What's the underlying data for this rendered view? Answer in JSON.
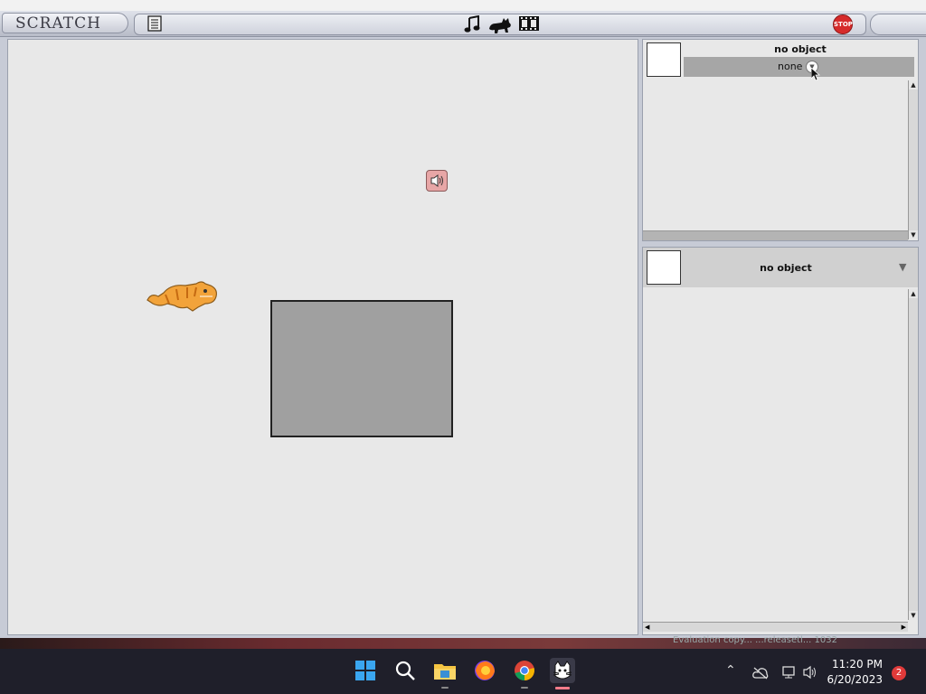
{
  "window": {
    "title_fragment": ""
  },
  "app": {
    "logo": "SCRATCH"
  },
  "toolbar": {
    "icons": [
      "notes-icon",
      "music-note-icon",
      "cat-icon",
      "film-icon"
    ],
    "stop_label": "STOP"
  },
  "top_pane": {
    "title": "no object",
    "dropdown_value": "none"
  },
  "bottom_pane": {
    "title": "no object"
  },
  "desktop": {
    "watermark": "Evaluation copy... ...releasetl... 1032"
  },
  "taskbar": {
    "time": "11:20 PM",
    "date": "6/20/2023",
    "notification_count": "2"
  },
  "colors": {
    "stage_bg": "#e8e8e8",
    "chrome": "#c7cbd6",
    "stop_red": "#d62b2b",
    "taskbar": "#1f1f2a"
  }
}
